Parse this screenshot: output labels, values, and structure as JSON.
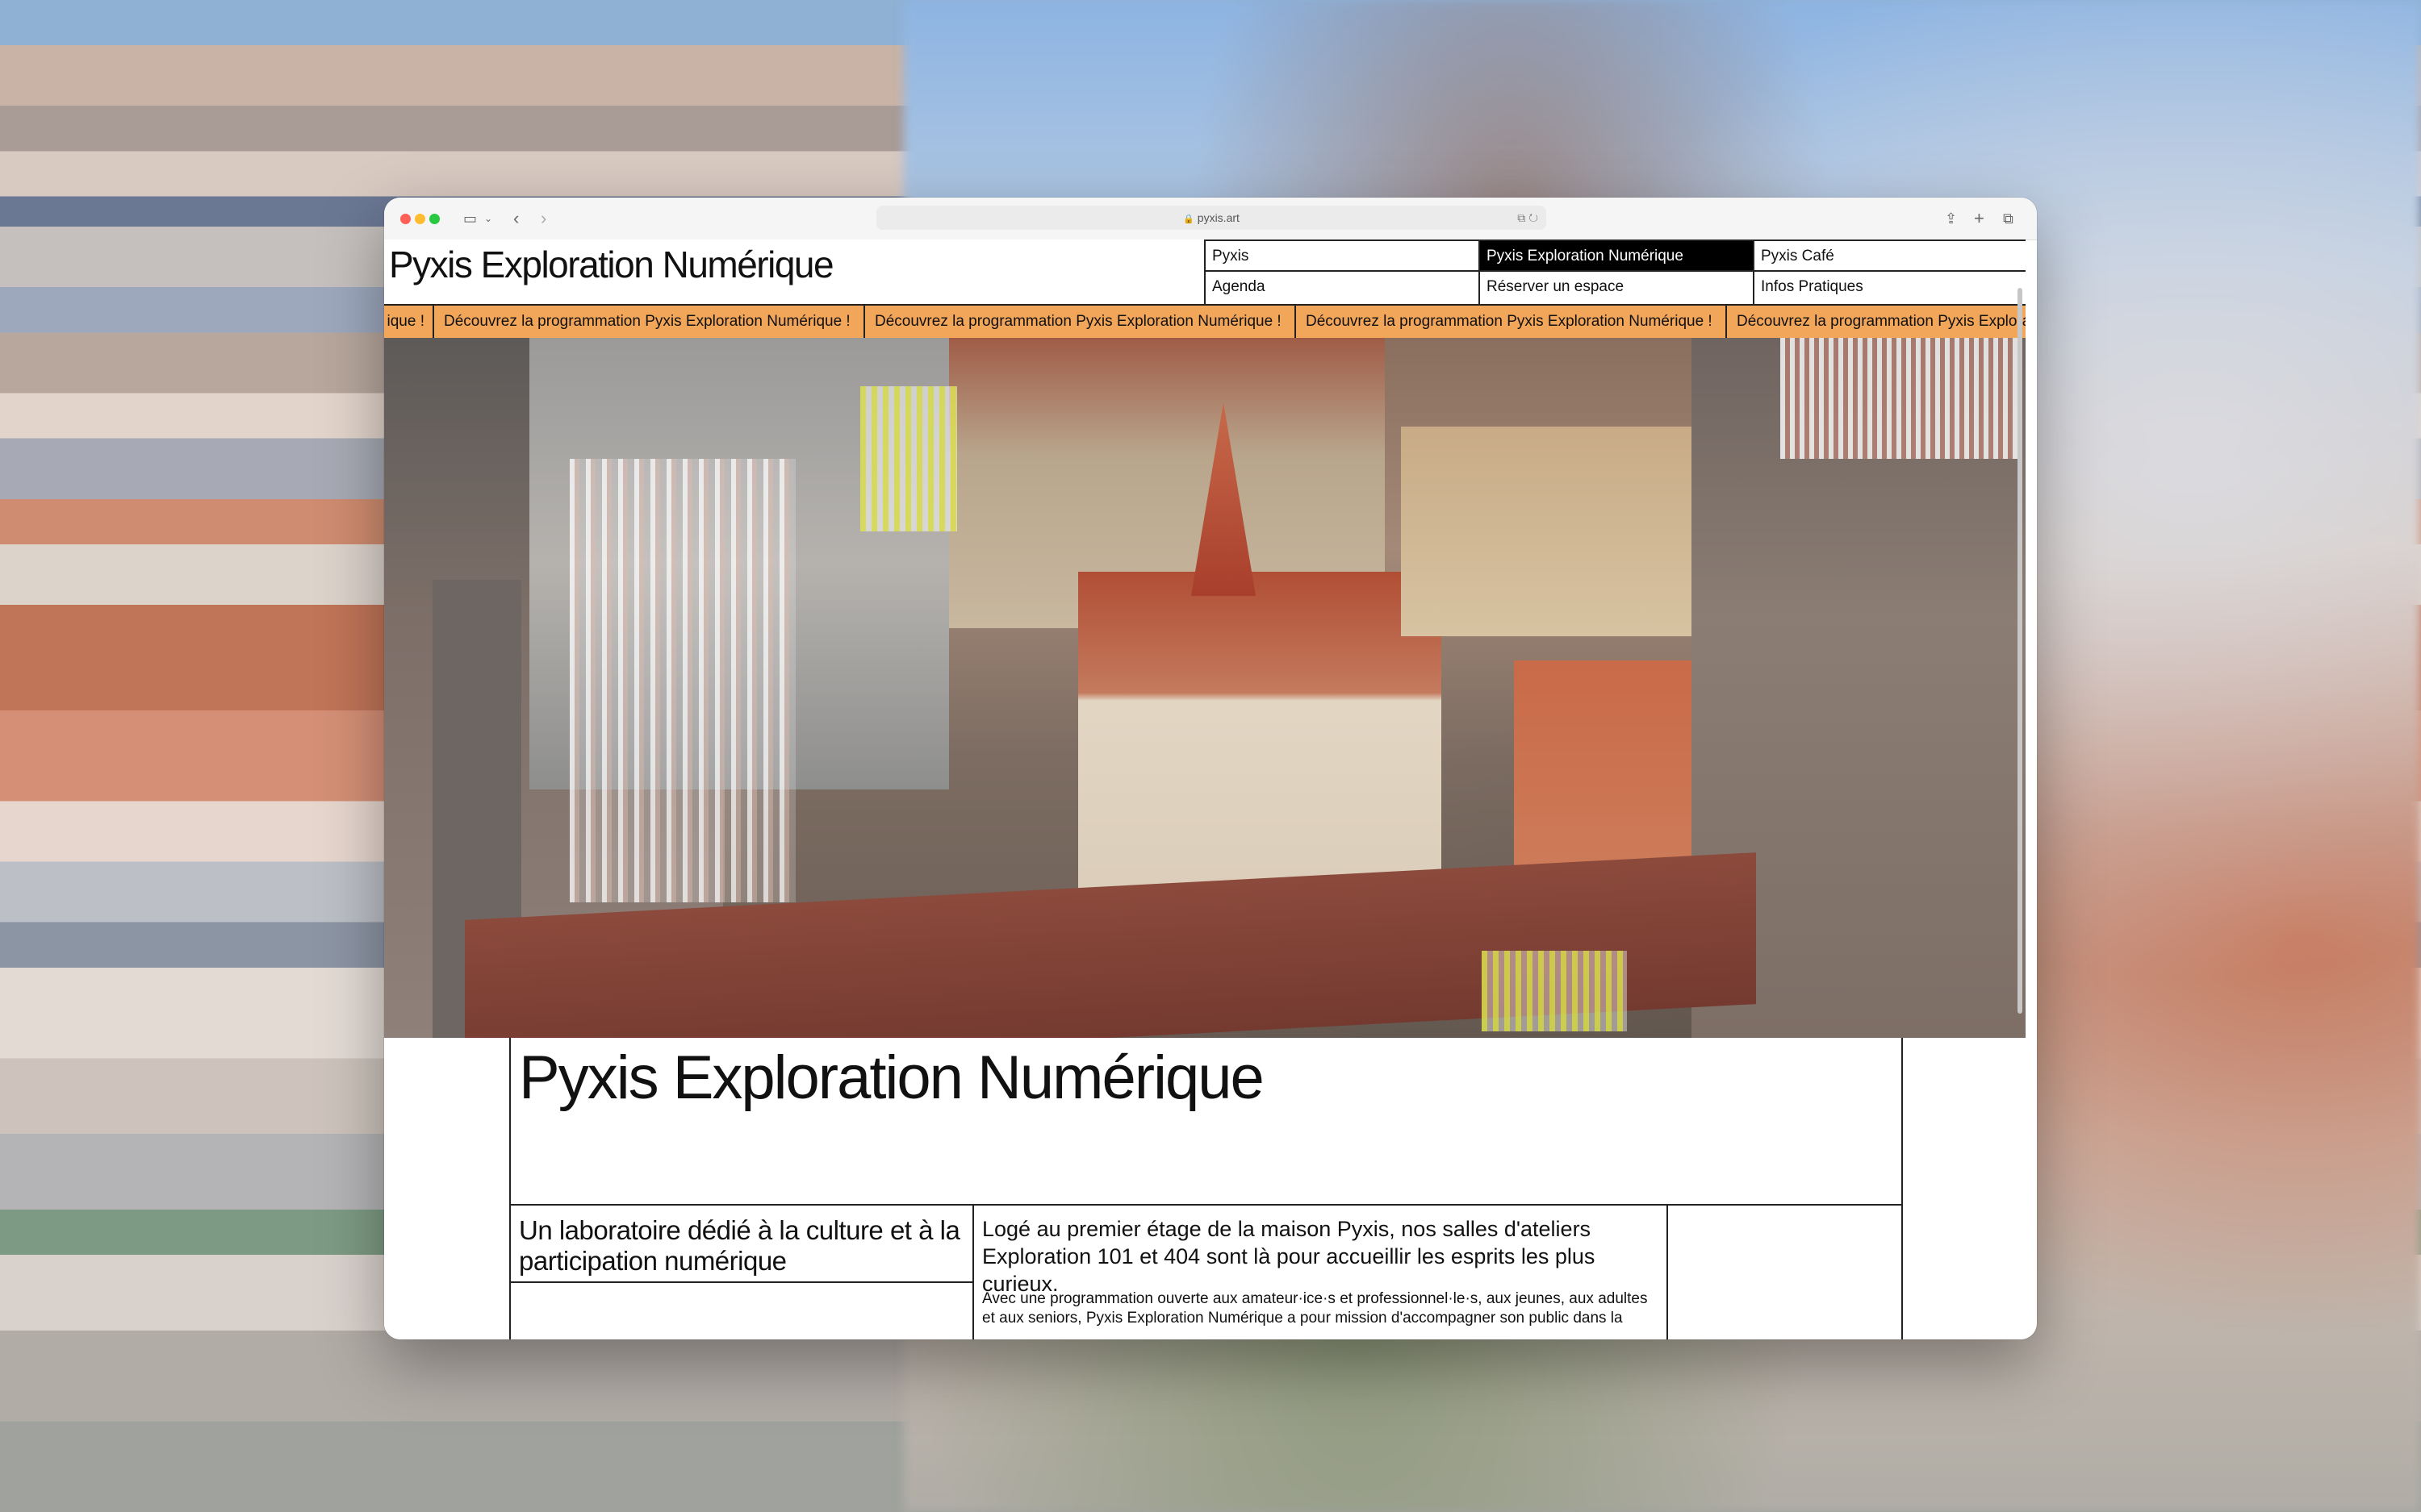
{
  "browser": {
    "url": "pyxis.art"
  },
  "site": {
    "title": "Pyxis Exploration Numérique",
    "nav": [
      {
        "label": "Pyxis",
        "active": false
      },
      {
        "label": "Pyxis Exploration Numérique",
        "active": true
      },
      {
        "label": "Pyxis Café",
        "active": false
      },
      {
        "label": "Agenda",
        "active": false
      },
      {
        "label": "Réserver un espace",
        "active": false
      },
      {
        "label": "Infos Pratiques",
        "active": false
      }
    ],
    "ticker": {
      "first": "ique !",
      "text": "Découvrez la programmation Pyxis Exploration Numérique !",
      "last": "Découvrez la programmation Pyxis Explora"
    }
  },
  "content": {
    "heading": "Pyxis Exploration Numérique",
    "subtitle": "Un laboratoire dédié à la culture et à la participation numérique",
    "lead": "Logé au premier étage de la maison Pyxis, nos salles d'ateliers Exploration 101 et 404 sont là pour accueillir les esprits les plus curieux.",
    "body": "Avec une programmation ouverte aux amateur·ice·s et professionnel·le·s, aux jeunes, aux adultes et aux seniors, Pyxis Exploration Numérique a pour mission d'accompagner son public dans la"
  },
  "colors": {
    "ticker_bg": "#f2a65a",
    "nav_active_bg": "#000000"
  }
}
